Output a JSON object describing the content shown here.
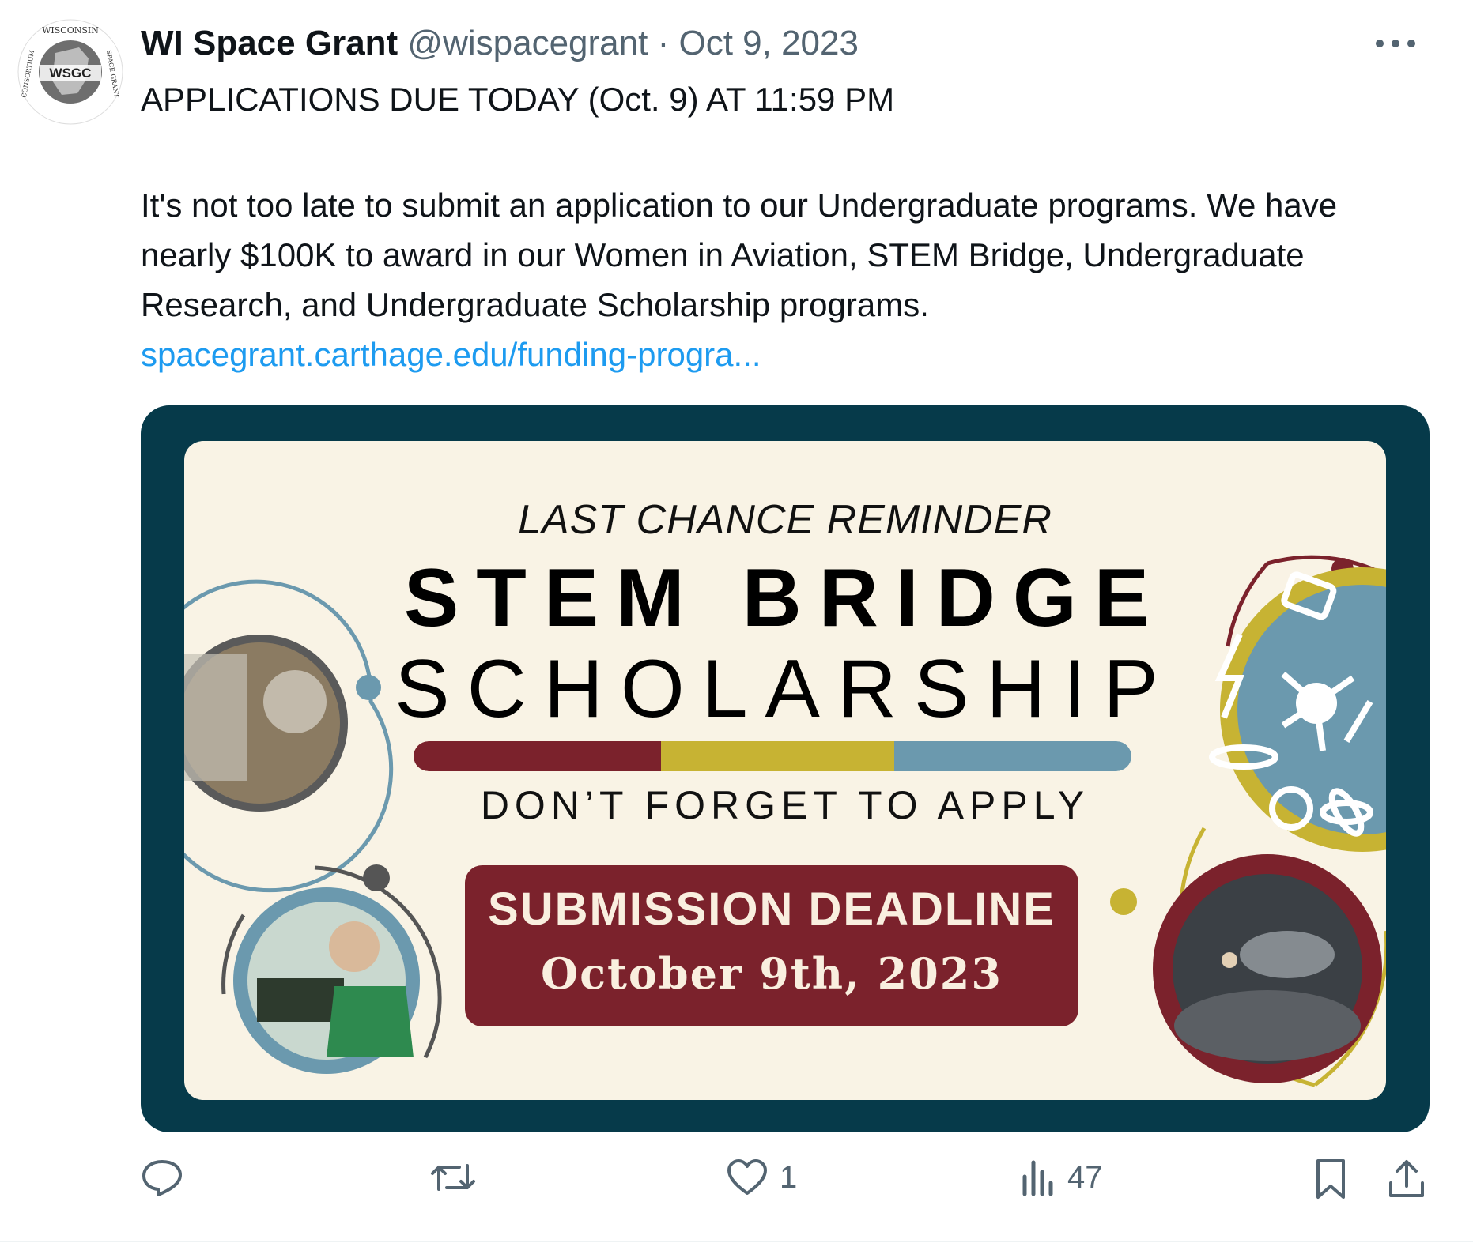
{
  "tweet": {
    "author_name": "WI Space Grant",
    "handle": "@wispacegrant",
    "separator": "·",
    "date": "Oct 9, 2023",
    "more_icon": "more-horizontal-icon",
    "headline": "APPLICATIONS DUE TODAY (Oct. 9) AT 11:59 PM",
    "body": "It's not too late to submit an application to our Undergraduate programs. We have nearly $100K to award in our Women in Aviation, STEM Bridge, Undergraduate Research, and Undergraduate Scholarship programs.",
    "link_text": "spacegrant.carthage.edu/funding-progra..."
  },
  "avatar": {
    "logo_text": "WSGC",
    "ring_top": "WISCONSIN",
    "ring_right": "SPACE GRANT",
    "ring_left": "CONSORTIUM"
  },
  "card": {
    "kicker": "LAST CHANCE REMINDER",
    "title_line1": "STEM BRIDGE",
    "title_line2": "SCHOLARSHIP",
    "cta": "DON’T FORGET TO APPLY",
    "deadline_label": "SUBMISSION DEADLINE",
    "deadline_date": "October 9th, 2023",
    "colors": {
      "frame": "#063a4a",
      "background": "#f9f3e5",
      "maroon": "#7b222c",
      "gold": "#c7b333",
      "blue": "#6b99ae"
    }
  },
  "actions": {
    "reply_icon": "reply-icon",
    "retweet_icon": "retweet-icon",
    "like_icon": "heart-icon",
    "like_count": "1",
    "views_icon": "views-icon",
    "views_count": "47",
    "bookmark_icon": "bookmark-icon",
    "share_icon": "share-icon"
  }
}
